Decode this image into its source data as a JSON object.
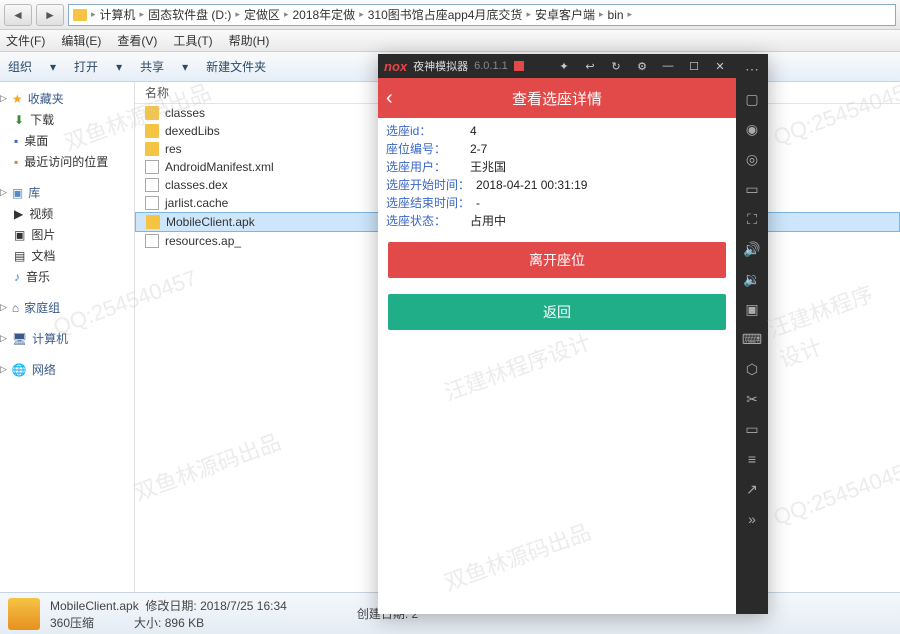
{
  "breadcrumb": [
    "计算机",
    "固态软件盘 (D:)",
    "定做区",
    "2018年定做",
    "310图书馆占座app4月底交货",
    "安卓客户端",
    "bin"
  ],
  "menu": {
    "file": "文件(F)",
    "edit": "编辑(E)",
    "view": "查看(V)",
    "tools": "工具(T)",
    "help": "帮助(H)"
  },
  "toolbar": {
    "organize": "组织",
    "open": "打开",
    "share": "共享",
    "newfolder": "新建文件夹"
  },
  "sidebar": {
    "favorites": {
      "head": "收藏夹",
      "items": [
        "下载",
        "桌面",
        "最近访问的位置"
      ]
    },
    "library": {
      "head": "库",
      "items": [
        "视频",
        "图片",
        "文档",
        "音乐"
      ]
    },
    "homegroup": "家庭组",
    "computer": "计算机",
    "network": "网络"
  },
  "filepane": {
    "colname": "名称",
    "files": [
      {
        "name": "classes",
        "type": "folder"
      },
      {
        "name": "dexedLibs",
        "type": "folder"
      },
      {
        "name": "res",
        "type": "folder"
      },
      {
        "name": "AndroidManifest.xml",
        "type": "doc"
      },
      {
        "name": "classes.dex",
        "type": "doc"
      },
      {
        "name": "jarlist.cache",
        "type": "doc"
      },
      {
        "name": "MobileClient.apk",
        "type": "apk",
        "selected": true
      },
      {
        "name": "resources.ap_",
        "type": "doc"
      }
    ]
  },
  "status": {
    "name": "MobileClient.apk",
    "mod_label": "修改日期:",
    "mod": "2018/7/25 16:34",
    "type": "360压缩",
    "size_label": "大小:",
    "size": "896 KB",
    "create_label": "创建日期:",
    "create": "2"
  },
  "nox": {
    "title": "夜神模拟器",
    "version": "6.0.1.1",
    "app_title": "查看选座详情",
    "rows": [
      {
        "label": "选座id：",
        "val": "4"
      },
      {
        "label": "座位编号：",
        "val": "2-7"
      },
      {
        "label": "选座用户：",
        "val": "王兆国"
      },
      {
        "label": "选座开始时间：",
        "val": "2018-04-21 00:31:19"
      },
      {
        "label": "选座结束时间：",
        "val": "-"
      },
      {
        "label": "选座状态：",
        "val": "占用中"
      }
    ],
    "btn_leave": "离开座位",
    "btn_back": "返回"
  },
  "watermarks": [
    "双鱼林源码出品",
    "QQ:254540457",
    "汪建林程序设计"
  ]
}
